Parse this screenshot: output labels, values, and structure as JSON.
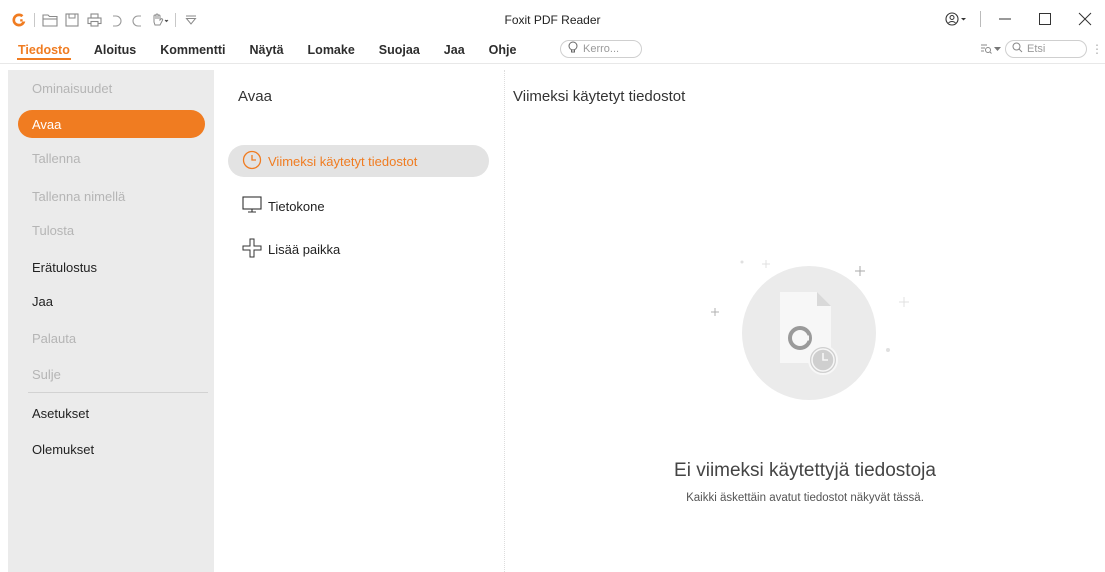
{
  "window": {
    "title": "Foxit PDF Reader"
  },
  "quick_access": {
    "icons": [
      "foxit-logo-icon",
      "open-folder-icon",
      "save-icon",
      "print-icon",
      "undo-icon",
      "redo-icon",
      "hand-tool-icon",
      "customize-dropdown-icon"
    ]
  },
  "ribbon": {
    "tabs": [
      "Tiedosto",
      "Aloitus",
      "Kommentti",
      "Näytä",
      "Lomake",
      "Suojaa",
      "Jaa",
      "Ohje"
    ],
    "active_tab": "Tiedosto",
    "tell_me_placeholder": "Kerro...",
    "search_placeholder": "Etsi"
  },
  "sidebar": {
    "items": [
      {
        "label": "Ominaisuudet",
        "state": "disabled"
      },
      {
        "label": "Avaa",
        "state": "active"
      },
      {
        "label": "Tallenna",
        "state": "disabled"
      },
      {
        "label": "Tallenna nimellä",
        "state": "disabled"
      },
      {
        "label": "Tulosta",
        "state": "disabled"
      },
      {
        "label": "Erätulostus",
        "state": "enabled"
      },
      {
        "label": "Jaa",
        "state": "enabled"
      },
      {
        "label": "Palauta",
        "state": "disabled"
      },
      {
        "label": "Sulje",
        "state": "disabled"
      },
      {
        "label": "Asetukset",
        "state": "enabled"
      },
      {
        "label": "Olemukset",
        "state": "enabled"
      }
    ]
  },
  "open_panel": {
    "heading": "Avaa",
    "locations": [
      {
        "label": "Viimeksi käytetyt tiedostot",
        "icon": "clock-icon",
        "active": true
      },
      {
        "label": "Tietokone",
        "icon": "computer-icon",
        "active": false
      },
      {
        "label": "Lisää paikka",
        "icon": "add-place-icon",
        "active": false
      }
    ]
  },
  "recent_panel": {
    "heading": "Viimeksi käytetyt tiedostot",
    "empty_title": "Ei viimeksi käytettyjä tiedostoja",
    "empty_subtitle": "Kaikki äskettäin avatut tiedostot näkyvät tässä."
  },
  "colors": {
    "accent": "#f07c21",
    "sidebar_bg": "#ebebeb",
    "selected_location_bg": "#e3e3e3"
  }
}
